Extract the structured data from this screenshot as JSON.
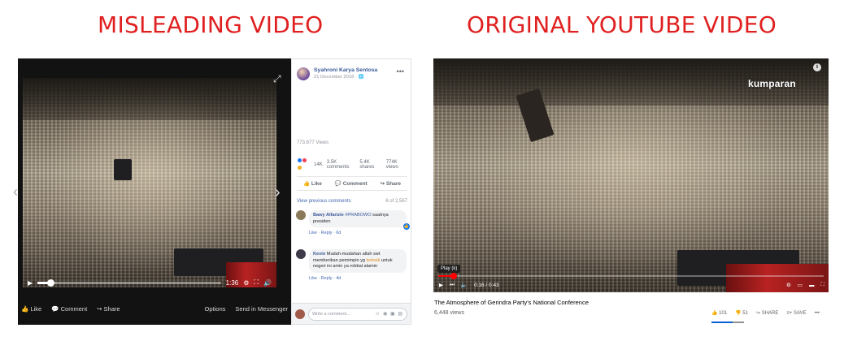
{
  "headings": {
    "left": "MISLEADING VIDEO",
    "right": "ORIGINAL YOUTUBE VIDEO"
  },
  "left_player": {
    "time": "1:36",
    "progress_fraction": 0.07,
    "bottom_bar": {
      "like": "Like",
      "comment": "Comment",
      "share": "Share",
      "options": "Options",
      "send": "Send in Messenger"
    }
  },
  "fb_post": {
    "author": "Syahroni Karya Sentosa",
    "date": "21 December 2018",
    "views": "773,677 Views",
    "reactions_count": "14K",
    "comments": "3.5K comments",
    "shares": "5.4K shares",
    "total_views": "774K views",
    "actions": {
      "like": "Like",
      "comment": "Comment",
      "share": "Share"
    },
    "view_previous": "View previous comments",
    "comment_count": "6 of 2,567",
    "comments_list": [
      {
        "name": "Bawy Alfarizie",
        "tag": "#PRABOWO",
        "text": " saatnya presiden",
        "meta": "Like · Reply · 6d"
      },
      {
        "name": "Kevin",
        "text_before": " Mudah-mudahan allah swt memberikan pemimpin yg ",
        "highlight": "terbaik",
        "text_after": " untuk negeri ini amin ya robbal alamin",
        "meta": "Like · Reply · 4d"
      }
    ],
    "compose_placeholder": "Write a comment..."
  },
  "right_player": {
    "logo": "kumparan",
    "info": "i",
    "tooltip": "Play (k)",
    "time": "0:16 / 0:43",
    "progress_fraction": 0.04
  },
  "youtube": {
    "title": "The Atmosphere of Gerindra Party's National Conference",
    "views": "6,448 views",
    "likes": "101",
    "dislikes": "51",
    "share": "SHARE",
    "save": "SAVE",
    "like_ratio": 0.66
  },
  "colors": {
    "heading": "#e02020",
    "fb_link": "#365899",
    "yt_red": "#ff0000"
  }
}
